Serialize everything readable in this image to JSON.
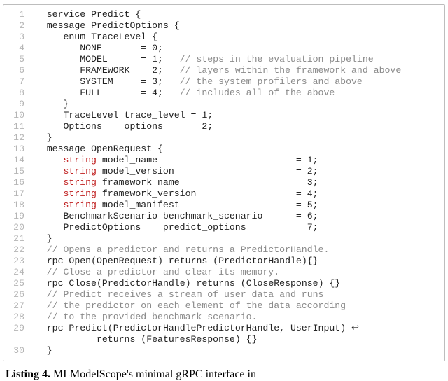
{
  "caption": {
    "label": "Listing 4.",
    "text": "MLModelScope's minimal gRPC interface in"
  },
  "lines": [
    {
      "n": 1,
      "indent": 1,
      "tokens": [
        {
          "t": "service ",
          "c": "tok"
        },
        {
          "t": "Predict ",
          "c": "tok"
        },
        {
          "t": "{ ",
          "c": "tok"
        }
      ]
    },
    {
      "n": 2,
      "indent": 1,
      "tokens": [
        {
          "t": "message ",
          "c": "tok"
        },
        {
          "t": "PredictOptions ",
          "c": "tok"
        },
        {
          "t": "{",
          "c": "tok"
        }
      ]
    },
    {
      "n": 3,
      "indent": 2,
      "tokens": [
        {
          "t": "enum ",
          "c": "tok"
        },
        {
          "t": "TraceLevel ",
          "c": "tok"
        },
        {
          "t": "{",
          "c": "tok"
        }
      ]
    },
    {
      "n": 4,
      "indent": 3,
      "tokens": [
        {
          "t": "NONE       = 0;",
          "c": "tok"
        }
      ]
    },
    {
      "n": 5,
      "indent": 3,
      "tokens": [
        {
          "t": "MODEL      = 1;   ",
          "c": "tok"
        },
        {
          "t": "// steps in the evaluation pipeline",
          "c": "cm"
        }
      ]
    },
    {
      "n": 6,
      "indent": 3,
      "tokens": [
        {
          "t": "FRAMEWORK  = 2;   ",
          "c": "tok"
        },
        {
          "t": "// layers within the framework and above",
          "c": "cm"
        }
      ]
    },
    {
      "n": 7,
      "indent": 3,
      "tokens": [
        {
          "t": "SYSTEM     = 3;   ",
          "c": "tok"
        },
        {
          "t": "// the system profilers and above",
          "c": "cm"
        }
      ]
    },
    {
      "n": 8,
      "indent": 3,
      "tokens": [
        {
          "t": "FULL       = 4;   ",
          "c": "tok"
        },
        {
          "t": "// includes all of the above",
          "c": "cm"
        }
      ]
    },
    {
      "n": 9,
      "indent": 2,
      "tokens": [
        {
          "t": "}",
          "c": "tok"
        }
      ]
    },
    {
      "n": 10,
      "indent": 2,
      "tokens": [
        {
          "t": "TraceLevel trace_level = 1;",
          "c": "tok"
        }
      ]
    },
    {
      "n": 11,
      "indent": 2,
      "tokens": [
        {
          "t": "Options    options     = 2;",
          "c": "tok"
        }
      ]
    },
    {
      "n": 12,
      "indent": 1,
      "tokens": [
        {
          "t": "}",
          "c": "tok"
        }
      ]
    },
    {
      "n": 13,
      "indent": 1,
      "tokens": [
        {
          "t": "message ",
          "c": "tok"
        },
        {
          "t": "OpenRequest ",
          "c": "tok"
        },
        {
          "t": "{",
          "c": "tok"
        }
      ]
    },
    {
      "n": 14,
      "indent": 2,
      "tokens": [
        {
          "t": "string",
          "c": "kw"
        },
        {
          "t": " model_name                         = 1;",
          "c": "tok"
        }
      ]
    },
    {
      "n": 15,
      "indent": 2,
      "tokens": [
        {
          "t": "string",
          "c": "kw"
        },
        {
          "t": " model_version                      = 2;",
          "c": "tok"
        }
      ]
    },
    {
      "n": 16,
      "indent": 2,
      "tokens": [
        {
          "t": "string",
          "c": "kw"
        },
        {
          "t": " framework_name                     = 3;",
          "c": "tok"
        }
      ]
    },
    {
      "n": 17,
      "indent": 2,
      "tokens": [
        {
          "t": "string",
          "c": "kw"
        },
        {
          "t": " framework_version                  = 4;",
          "c": "tok"
        }
      ]
    },
    {
      "n": 18,
      "indent": 2,
      "tokens": [
        {
          "t": "string",
          "c": "kw"
        },
        {
          "t": " model_manifest                     = 5;",
          "c": "tok"
        }
      ]
    },
    {
      "n": 19,
      "indent": 2,
      "tokens": [
        {
          "t": "BenchmarkScenario benchmark_scenario      = 6;",
          "c": "tok"
        }
      ]
    },
    {
      "n": 20,
      "indent": 2,
      "tokens": [
        {
          "t": "PredictOptions    predict_options         = 7;",
          "c": "tok"
        }
      ]
    },
    {
      "n": 21,
      "indent": 1,
      "tokens": [
        {
          "t": "}",
          "c": "tok"
        }
      ]
    },
    {
      "n": 22,
      "indent": 1,
      "tokens": [
        {
          "t": "// Opens a predictor and returns a PredictorHandle.",
          "c": "cm"
        }
      ]
    },
    {
      "n": 23,
      "indent": 1,
      "tokens": [
        {
          "t": "rpc ",
          "c": "tok"
        },
        {
          "t": "Open",
          "c": "tok"
        },
        {
          "t": "(",
          "c": "tok"
        },
        {
          "t": "OpenRequest",
          "c": "tok"
        },
        {
          "t": ") ",
          "c": "tok"
        },
        {
          "t": "returns ",
          "c": "tok"
        },
        {
          "t": "(",
          "c": "tok"
        },
        {
          "t": "PredictorHandle",
          "c": "tok"
        },
        {
          "t": "){}",
          "c": "tok"
        }
      ]
    },
    {
      "n": 24,
      "indent": 1,
      "tokens": [
        {
          "t": "// Close a predictor and clear its memory.",
          "c": "cm"
        }
      ]
    },
    {
      "n": 25,
      "indent": 1,
      "tokens": [
        {
          "t": "rpc ",
          "c": "tok"
        },
        {
          "t": "Close",
          "c": "tok"
        },
        {
          "t": "(",
          "c": "tok"
        },
        {
          "t": "PredictorHandle",
          "c": "tok"
        },
        {
          "t": ") ",
          "c": "tok"
        },
        {
          "t": "returns ",
          "c": "tok"
        },
        {
          "t": "(",
          "c": "tok"
        },
        {
          "t": "CloseResponse",
          "c": "tok"
        },
        {
          "t": ") {}",
          "c": "tok"
        }
      ]
    },
    {
      "n": 26,
      "indent": 1,
      "tokens": [
        {
          "t": "// Predict receives a stream of user data and runs",
          "c": "cm"
        }
      ]
    },
    {
      "n": 27,
      "indent": 1,
      "tokens": [
        {
          "t": "// the predictor on each element of the data according",
          "c": "cm"
        }
      ]
    },
    {
      "n": 28,
      "indent": 1,
      "tokens": [
        {
          "t": "// to the provided benchmark scenario.",
          "c": "cm"
        }
      ]
    },
    {
      "n": 29,
      "indent": 1,
      "tokens": [
        {
          "t": "rpc ",
          "c": "tok"
        },
        {
          "t": "Predict",
          "c": "tok"
        },
        {
          "t": "(",
          "c": "tok"
        },
        {
          "t": "PredictorHandlePredictorHandle",
          "c": "tok"
        },
        {
          "t": ", ",
          "c": "tok"
        },
        {
          "t": "UserInput",
          "c": "tok"
        },
        {
          "t": ") ",
          "c": "tok"
        },
        {
          "t": "↩",
          "c": "tok"
        }
      ]
    },
    {
      "n": "",
      "indent": 4,
      "tokens": [
        {
          "t": "returns ",
          "c": "tok"
        },
        {
          "t": "(",
          "c": "tok"
        },
        {
          "t": "FeaturesResponse",
          "c": "tok"
        },
        {
          "t": ") {}",
          "c": "tok"
        }
      ]
    },
    {
      "n": 30,
      "indent": 1,
      "tokens": [
        {
          "t": "}",
          "c": "tok"
        }
      ]
    }
  ]
}
